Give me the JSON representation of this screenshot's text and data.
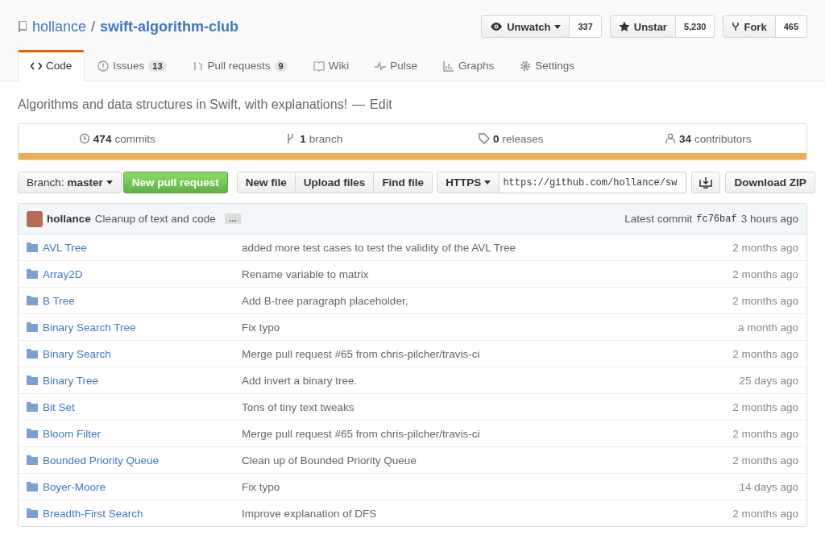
{
  "repo": {
    "owner": "hollance",
    "separator": "/",
    "name": "swift-algorithm-club"
  },
  "actions": [
    {
      "kind": "watch",
      "label": "Unwatch",
      "count": "337"
    },
    {
      "kind": "star",
      "label": "Unstar",
      "count": "5,230"
    },
    {
      "kind": "fork",
      "label": "Fork",
      "count": "465"
    }
  ],
  "tabs": [
    {
      "kind": "code",
      "label": "Code",
      "selected": true
    },
    {
      "kind": "issues",
      "label": "Issues",
      "count": "13",
      "selected": false
    },
    {
      "kind": "pulls",
      "label": "Pull requests",
      "count": "9",
      "selected": false
    },
    {
      "kind": "wiki",
      "label": "Wiki",
      "selected": false
    },
    {
      "kind": "pulse",
      "label": "Pulse",
      "selected": false
    },
    {
      "kind": "graphs",
      "label": "Graphs",
      "selected": false
    },
    {
      "kind": "settings",
      "label": "Settings",
      "selected": false
    }
  ],
  "description": {
    "text": "Algorithms and data structures in Swift, with explanations!",
    "separator": "—",
    "edit": "Edit"
  },
  "stats": [
    {
      "kind": "commits",
      "number": "474",
      "label": "commits"
    },
    {
      "kind": "branch",
      "number": "1",
      "label": "branch"
    },
    {
      "kind": "releases",
      "number": "0",
      "label": "releases"
    },
    {
      "kind": "contributors",
      "number": "34",
      "label": "contributors"
    }
  ],
  "toolbar": {
    "branch_label": "Branch:",
    "branch": "master",
    "new_pr": "New pull request",
    "file_buttons": [
      "New file",
      "Upload files",
      "Find file"
    ],
    "protocol": "HTTPS",
    "clone_url": "https://github.com/hollance/sw",
    "download": "Download ZIP"
  },
  "latest_commit": {
    "author": "hollance",
    "message": "Cleanup of text and code",
    "ellipsis": "…",
    "label": "Latest commit",
    "sha": "fc76baf",
    "time": "3 hours ago"
  },
  "files": [
    {
      "name": "AVL Tree",
      "message": "added more test cases to test the validity of the AVL Tree",
      "age": "2 months ago"
    },
    {
      "name": "Array2D",
      "message": "Rename variable to matrix",
      "age": "2 months ago"
    },
    {
      "name": "B Tree",
      "message": "Add B-tree paragraph placeholder,",
      "age": "2 months ago"
    },
    {
      "name": "Binary Search Tree",
      "message": "Fix typo",
      "age": "a month ago"
    },
    {
      "name": "Binary Search",
      "message": "Merge pull request #65 from chris-pilcher/travis-ci",
      "age": "2 months ago"
    },
    {
      "name": "Binary Tree",
      "message": "Add invert a binary tree.",
      "age": "25 days ago"
    },
    {
      "name": "Bit Set",
      "message": "Tons of tiny text tweaks",
      "age": "2 months ago"
    },
    {
      "name": "Bloom Filter",
      "message": "Merge pull request #65 from chris-pilcher/travis-ci",
      "age": "2 months ago"
    },
    {
      "name": "Bounded Priority Queue",
      "message": "Clean up of Bounded Priority Queue",
      "age": "2 months ago"
    },
    {
      "name": "Boyer-Moore",
      "message": "Fix typo",
      "age": "14 days ago"
    },
    {
      "name": "Breadth-First Search",
      "message": "Improve explanation of DFS",
      "age": "2 months ago"
    }
  ]
}
